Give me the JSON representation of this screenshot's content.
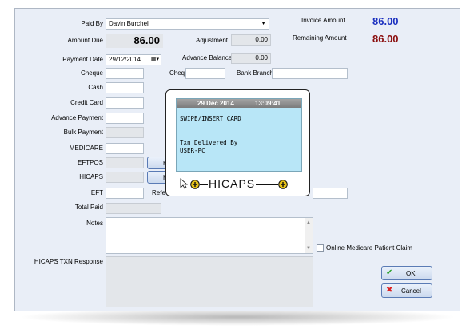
{
  "form": {
    "paid_by_label": "Paid By",
    "paid_by_value": "Davin Burchell",
    "invoice_amount_label": "Invoice Amount",
    "invoice_amount_value": "86.00",
    "amount_due_label": "Amount Due",
    "amount_due_value": "86.00",
    "adjustment_label": "Adjustment",
    "adjustment_value": "0.00",
    "remaining_amount_label": "Remaining Amount",
    "remaining_amount_value": "86.00",
    "payment_date_label": "Payment Date",
    "payment_date_value": "29/12/2014",
    "advance_balance_label": "Advance Balance",
    "advance_balance_value": "0.00",
    "cheque_label": "Cheque",
    "cheque_no_label": "Cheque #",
    "bank_branch_label": "Bank Branch",
    "cash_label": "Cash",
    "credit_card_label": "Credit Card",
    "advance_payment_label": "Advance Payment",
    "bulk_payment_label": "Bulk Payment",
    "medicare_label": "MEDICARE",
    "eftpos_label": "EFTPOS",
    "eftpos_button_label": "E",
    "hicaps_label": "HICAPS",
    "hicaps_button_label": "H",
    "eft_label": "EFT",
    "eft_ref_label": "Refe",
    "total_paid_label": "Total Paid",
    "notes_label": "Notes",
    "online_medicare_label": "Online Medicare Patient Claim",
    "hicaps_txn_response_label": "HICAPS TXN Response",
    "ok_label": "OK",
    "cancel_label": "Cancel"
  },
  "terminal": {
    "date": "29 Dec 2014",
    "time": "13:09:41",
    "line1": "SWIPE/INSERT CARD",
    "line2": "Txn Delivered By",
    "line3": "USER-PC",
    "logo_text": "HICAPS"
  },
  "colors": {
    "invoice_amount": "#1a2fbf",
    "remaining_amount": "#8b0f0f",
    "lcd": "#b8e6f7",
    "window": "#e9eef7"
  }
}
